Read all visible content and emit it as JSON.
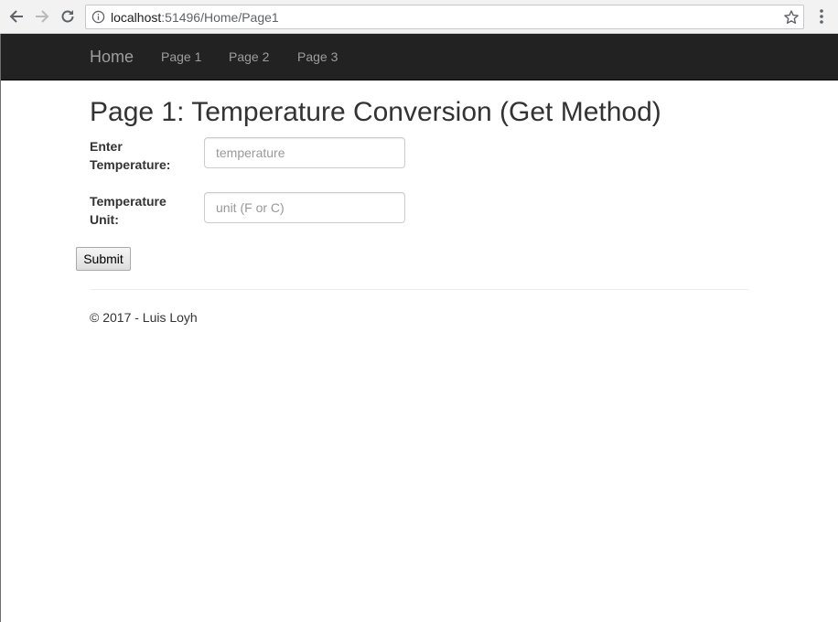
{
  "browser": {
    "url_host": "localhost",
    "url_rest": ":51496/Home/Page1"
  },
  "navbar": {
    "brand": "Home",
    "links": [
      "Page 1",
      "Page 2",
      "Page 3"
    ]
  },
  "main": {
    "title": "Page 1: Temperature Conversion (Get Method)",
    "fields": [
      {
        "label_line1": "Enter",
        "label_line2": "Temperature:",
        "placeholder": "temperature",
        "value": ""
      },
      {
        "label_line1": "Temperature",
        "label_line2": "Unit:",
        "placeholder": "unit (F or C)",
        "value": ""
      }
    ],
    "submit_label": "Submit"
  },
  "footer": {
    "text": "© 2017 - Luis Loyh"
  },
  "colors": {
    "navbar_bg": "#222222",
    "navbar_text": "#9d9d9d",
    "text": "#333333"
  }
}
